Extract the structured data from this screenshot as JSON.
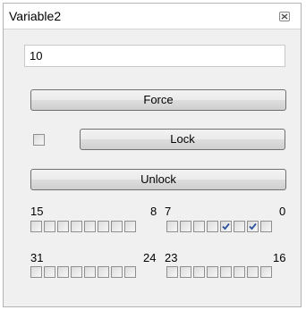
{
  "window": {
    "title": "Variable2"
  },
  "value": {
    "text": "10"
  },
  "buttons": {
    "force": "Force",
    "lock": "Lock",
    "unlock": "Unlock"
  },
  "lock_checkbox": {
    "checked": false
  },
  "bits": {
    "low_byte_high_label": "15",
    "low_byte_low_label": "8",
    "byte0_high_label": "7",
    "byte0_low_label": "0",
    "byte3_high_label": "31",
    "byte3_low_label": "24",
    "byte2_high_label": "23",
    "byte2_low_label": "16",
    "group_15_8": [
      false,
      false,
      false,
      false,
      false,
      false,
      false,
      false
    ],
    "group_7_0": [
      false,
      false,
      false,
      false,
      true,
      false,
      true,
      false
    ],
    "group_31_24": [
      false,
      false,
      false,
      false,
      false,
      false,
      false,
      false
    ],
    "group_23_16": [
      false,
      false,
      false,
      false,
      false,
      false,
      false,
      false
    ]
  },
  "icons": {
    "close": "close-icon",
    "check": "check-mark-icon"
  }
}
